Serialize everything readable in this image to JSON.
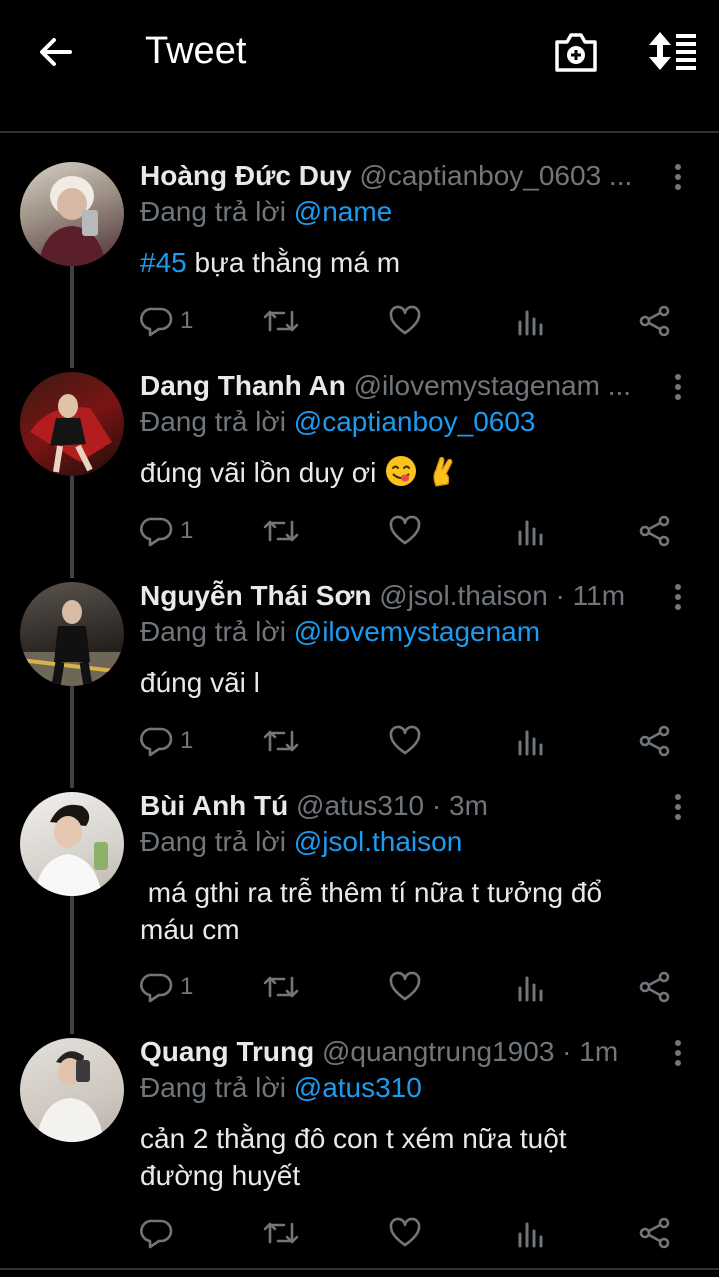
{
  "header": {
    "title": "Tweet"
  },
  "tweets": [
    {
      "name": "Hoàng Đức Duy",
      "handle": "@captianboy_0603 ...",
      "reply_prefix": "Đang trả lời ",
      "reply_to": "@name",
      "hashtag": "#45",
      "text": " bựa thằng má m",
      "reply_count": "1",
      "avatar_color": "#8a7f78"
    },
    {
      "name": "Dang Thanh An",
      "handle": "@ilovemystagenam ...",
      "reply_prefix": "Đang trả lời ",
      "reply_to": "@captianboy_0603",
      "text": "đúng vãi lồn duy ơi",
      "emoji": [
        "yum-emoji",
        "crossed-fingers-emoji"
      ],
      "reply_count": "1",
      "avatar_color": "#6e1a1a"
    },
    {
      "name": "Nguyễn Thái Sơn",
      "handle": "@jsol.thaison · 11m",
      "reply_prefix": "Đang trả lời ",
      "reply_to": "@ilovemystagenam",
      "text": "đúng vãi l",
      "reply_count": "1",
      "avatar_color": "#3a3530"
    },
    {
      "name": "Bùi Anh Tú",
      "handle": "@atus310 · 3m",
      "reply_prefix": "Đang trả lời ",
      "reply_to": "@jsol.thaison",
      "text_line1": " má gthi ra trễ thêm tí nữa t tưởng đổ",
      "text_line2": "máu cm",
      "reply_count": "1",
      "avatar_color": "#d9d6d2"
    },
    {
      "name": "Quang Trung",
      "handle": "@quangtrung1903 · 1m",
      "reply_prefix": "Đang trả lời ",
      "reply_to": "@atus310",
      "text_line1": "cản 2 thằng đô con t xém nữa tuột",
      "text_line2": "đường huyết",
      "reply_count": "",
      "avatar_color": "#c9c4be"
    }
  ],
  "colors": {
    "background": "#000000",
    "accent": "#1d9bf0",
    "muted": "#71767b",
    "text": "#e7e9ea"
  }
}
